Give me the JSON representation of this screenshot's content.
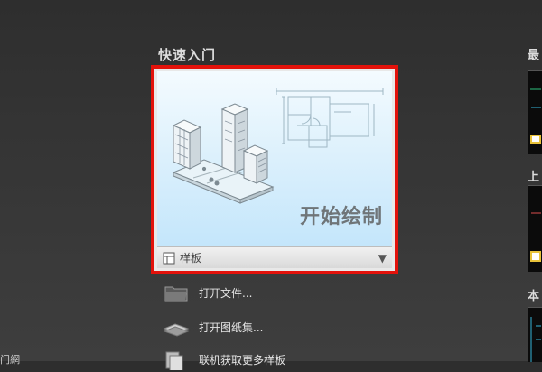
{
  "section_title": "快速入门",
  "start_card": {
    "caption": "开始绘制",
    "template_label": "样板",
    "template_dropdown_arrow": "▼"
  },
  "actions": [
    {
      "label": "打开文件...",
      "icon": "folder-icon"
    },
    {
      "label": "打开图纸集...",
      "icon": "sheet-set-icon"
    },
    {
      "label": "联机获取更多样板",
      "icon": "online-templates-icon"
    }
  ],
  "right_panel": {
    "title_recent": "最",
    "title_last": "上",
    "title_local": "本"
  },
  "left_fragment": "门網"
}
